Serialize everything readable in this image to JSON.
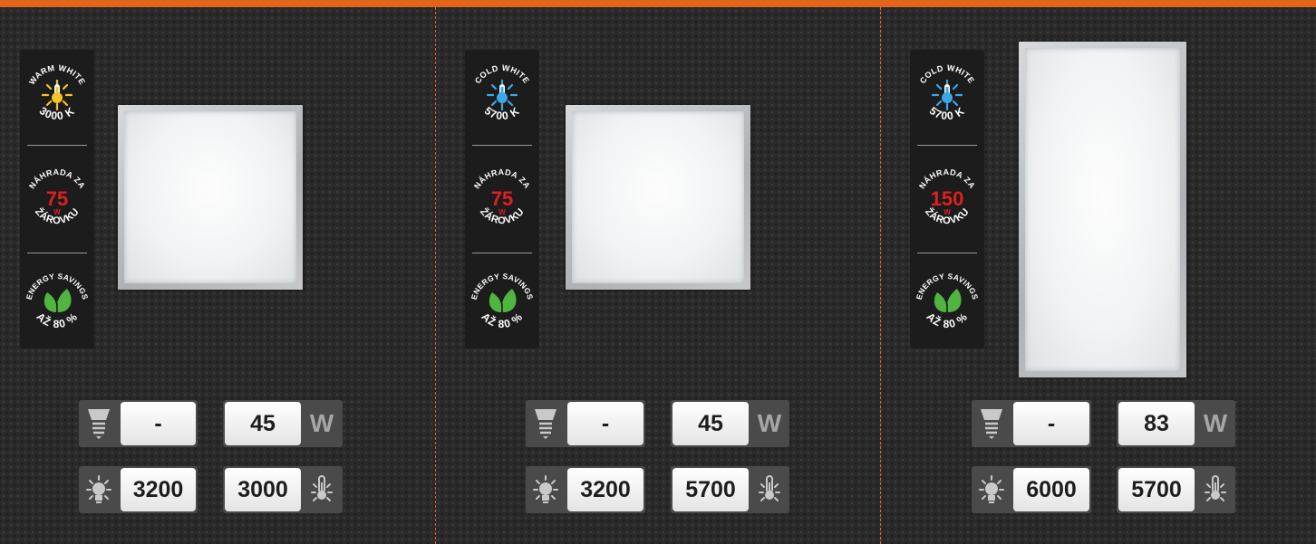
{
  "colors": {
    "accent": "#e2641a",
    "warm": "#f3c42a",
    "cold": "#3da7e6",
    "watt": "#e01f1f",
    "leaf": "#4fb53f"
  },
  "products": [
    {
      "temp_label": "WARM WHITE",
      "temp_value": "3000 K",
      "bulb_color": "#f3c42a",
      "replace_label": "NÁHRADA ZA",
      "replace_watts": "75",
      "replace_unit": "W",
      "replace_bottom": "ŽÁROVKU",
      "energy_label": "ENERGY SAVINGS",
      "energy_bottom": "AŽ 80 %",
      "bulb_equivalent": "-",
      "power": "45",
      "power_unit": "W",
      "lumen": "3200",
      "kelvin": "3000",
      "panel_shape": "square"
    },
    {
      "temp_label": "COLD WHITE",
      "temp_value": "5700 K",
      "bulb_color": "#3da7e6",
      "replace_label": "NÁHRADA ZA",
      "replace_watts": "75",
      "replace_unit": "W",
      "replace_bottom": "ŽÁROVKU",
      "energy_label": "ENERGY SAVINGS",
      "energy_bottom": "AŽ 80 %",
      "bulb_equivalent": "-",
      "power": "45",
      "power_unit": "W",
      "lumen": "3200",
      "kelvin": "5700",
      "panel_shape": "square"
    },
    {
      "temp_label": "COLD WHITE",
      "temp_value": "5700 K",
      "bulb_color": "#3da7e6",
      "replace_label": "NÁHRADA ZA",
      "replace_watts": "150",
      "replace_unit": "W",
      "replace_bottom": "ŽÁROVKU",
      "energy_label": "ENERGY SAVINGS",
      "energy_bottom": "AŽ 80 %",
      "bulb_equivalent": "-",
      "power": "83",
      "power_unit": "W",
      "lumen": "6000",
      "kelvin": "5700",
      "panel_shape": "rectangle"
    }
  ]
}
